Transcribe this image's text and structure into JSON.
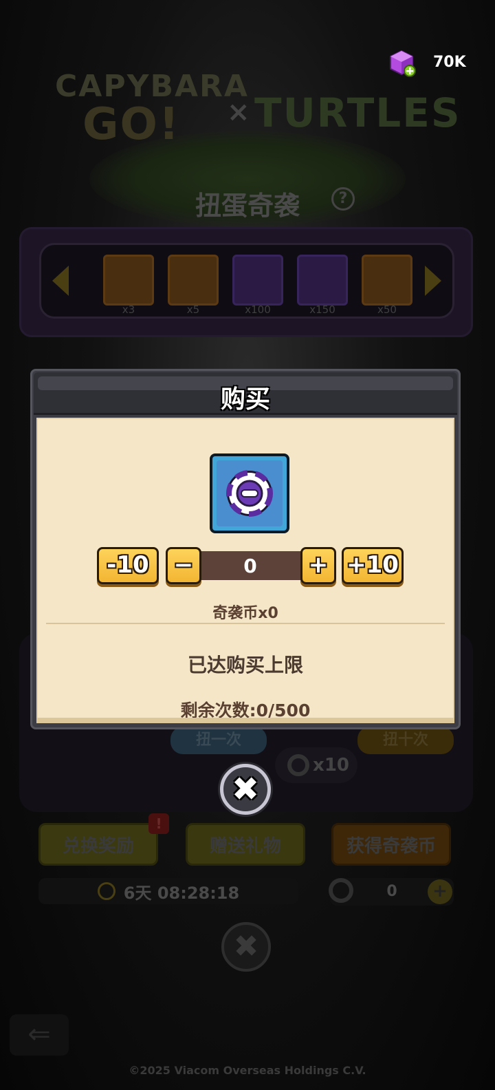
{
  "currency": {
    "gem_icon": "purple-gem-with-plus-icon",
    "amount": "70K"
  },
  "background": {
    "logo_left": "CAPYBARA",
    "logo_go": "GO!",
    "logo_x": "×",
    "logo_right": "TURTLES",
    "event_title": "扭蛋奇袭",
    "help_label": "?",
    "rewards": [
      {
        "count": "x3",
        "color": "orange"
      },
      {
        "count": "x5",
        "color": "orange"
      },
      {
        "count": "x100",
        "color": "purple"
      },
      {
        "count": "x150",
        "color": "purple"
      },
      {
        "count": "x50",
        "color": "orange"
      }
    ],
    "spin_once": "扭一次",
    "spin_ten": "扭十次",
    "spin_cost": "x10",
    "exchange_label": "兑换奖励",
    "alert_label": "!",
    "gift_label": "赠送礼物",
    "get_coins_label": "获得奇袭币",
    "countdown": "6天 08:28:18",
    "coin_count": "0",
    "plus_label": "+",
    "back_label": "⇐",
    "close_label": "✖",
    "copyright": "©2025 Viacom Overseas Holdings C.V."
  },
  "modal": {
    "title": "购买",
    "item_icon": "raid-coin-icon",
    "stepper": {
      "minus10_label": "-10",
      "minus_label": "−",
      "quantity": "0",
      "plus_label": "+",
      "plus10_label": "+10"
    },
    "item_label": "奇袭币x0",
    "limit_message": "已达购买上限",
    "remaining": "剩余次数:0/500",
    "close_label": "✖"
  },
  "colors": {
    "modal_body": "#f5e6c8",
    "button_gold": "#f7c445",
    "item_frame": "#43a6d8",
    "quantity_field": "#5c4238"
  }
}
